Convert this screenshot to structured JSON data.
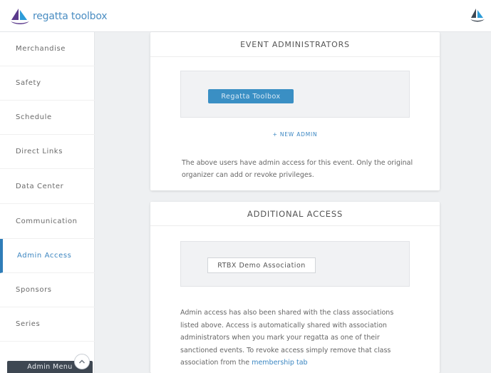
{
  "header": {
    "logo_text": "regatta toolbox",
    "brand_color": "#4a8dc2"
  },
  "sidebar": {
    "items": [
      {
        "label": "Merchandise",
        "active": false
      },
      {
        "label": "Safety",
        "active": false
      },
      {
        "label": "Schedule",
        "active": false
      },
      {
        "label": "Direct Links",
        "active": false
      },
      {
        "label": "Data Center",
        "active": false
      },
      {
        "label": "Communication",
        "active": false
      },
      {
        "label": "Admin Access",
        "active": true
      },
      {
        "label": "Sponsors",
        "active": false
      },
      {
        "label": "Series",
        "active": false
      }
    ],
    "admin_menu_label": "Admin Menu"
  },
  "event_admins": {
    "title": "EVENT ADMINISTRATORS",
    "users": [
      "Regatta Toolbox"
    ],
    "new_admin_label": "+ NEW ADMIN",
    "description": "The above users have admin access for this event. Only the original organizer can add or revoke privileges."
  },
  "additional_access": {
    "title": "ADDITIONAL ACCESS",
    "associations": [
      "RTBX Demo Association"
    ],
    "description": "Admin access has also been shared with the class associations listed above. Access is automatically shared with association administrators when you mark your regatta as one of their sanctioned events. To revoke access simply remove that class association from the",
    "link_text": "membership tab"
  }
}
